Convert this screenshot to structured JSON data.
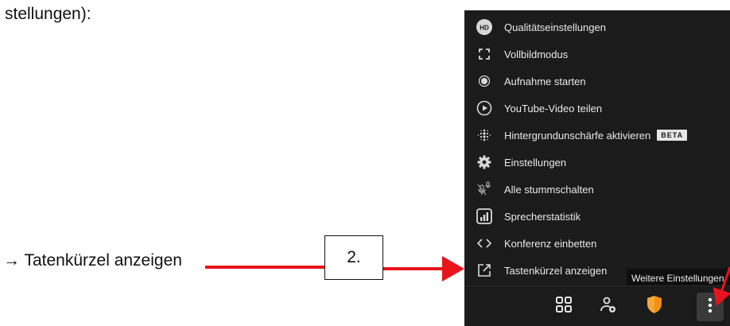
{
  "document": {
    "heading_fragment": "stellungen):",
    "bullet_arrow": "→",
    "bullet_text": "Tatenkürzel anzeigen",
    "callout_label": "2."
  },
  "menu": {
    "items": [
      {
        "icon": "hd-icon",
        "label": "Qualitätseinstellungen"
      },
      {
        "icon": "fullscreen-icon",
        "label": "Vollbildmodus"
      },
      {
        "icon": "record-icon",
        "label": "Aufnahme starten"
      },
      {
        "icon": "play-circle-icon",
        "label": "YouTube-Video teilen"
      },
      {
        "icon": "blur-icon",
        "label": "Hintergrundunschärfe aktivieren",
        "badge": "BETA"
      },
      {
        "icon": "gear-icon",
        "label": "Einstellungen"
      },
      {
        "icon": "mute-all-icon",
        "label": "Alle stummschalten"
      },
      {
        "icon": "bar-chart-icon",
        "label": "Sprecherstatistik"
      },
      {
        "icon": "code-icon",
        "label": "Konferenz einbetten"
      },
      {
        "icon": "external-link-icon",
        "label": "Tastenkürzel anzeigen"
      }
    ]
  },
  "tooltip": {
    "text": "Weitere Einstellungen"
  },
  "toolbar": {
    "buttons": [
      "tile-view-icon",
      "invite-person-icon",
      "shield-icon",
      "more-vertical-icon"
    ],
    "hd_badge": "HD"
  },
  "colors": {
    "panel_bg": "#1b1b1b",
    "arrow_red": "#e8141b",
    "shield_orange": "#f29111"
  }
}
